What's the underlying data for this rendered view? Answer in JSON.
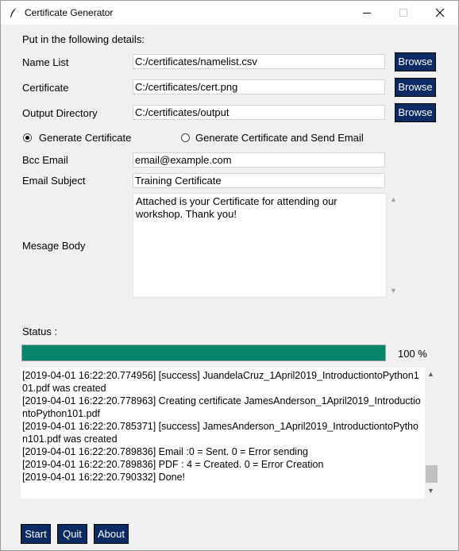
{
  "window": {
    "title": "Certificate Generator"
  },
  "form": {
    "heading": "Put in the following details:",
    "name_list": {
      "label": "Name List",
      "value": "C:/certificates/namelist.csv",
      "browse_label": "Browse"
    },
    "certificate": {
      "label": "Certificate",
      "value": "C:/certificates/cert.png",
      "browse_label": "Browse"
    },
    "output_directory": {
      "label": "Output Directory",
      "value": "C:/certificates/output",
      "browse_label": "Browse"
    },
    "mode": {
      "options": [
        "Generate Certificate",
        "Generate Certificate and Send Email"
      ],
      "selected": "Generate Certificate"
    },
    "bcc_email": {
      "label": "Bcc Email",
      "value": "email@example.com"
    },
    "email_subject": {
      "label": "Email Subject",
      "value": "Training Certificate"
    },
    "message_body": {
      "label": "Mesage Body",
      "value": "Attached is your Certificate for attending our\nworkshop. Thank you!"
    }
  },
  "status": {
    "label": "Status :",
    "progress_percent": 100,
    "progress_text": "100 %",
    "log_lines": [
      "[2019-04-01 16:22:20.774956] [success] JuandelaCruz_1April2019_IntroductiontoPython101.pdf was created",
      "[2019-04-01 16:22:20.778963] Creating certificate JamesAnderson_1April2019_IntroductiontoPython101.pdf",
      "[2019-04-01 16:22:20.785371] [success] JamesAnderson_1April2019_IntroductiontoPython101.pdf was created",
      "[2019-04-01 16:22:20.789836] Email :0 = Sent. 0 = Error sending",
      "[2019-04-01 16:22:20.789836] PDF : 4 = Created. 0 = Error Creation",
      "[2019-04-01 16:22:20.790332] Done!"
    ]
  },
  "buttons": {
    "start": "Start",
    "quit": "Quit",
    "about": "About"
  },
  "colors": {
    "button_bg": "#0a2a63",
    "progress_fill": "#08836c"
  }
}
